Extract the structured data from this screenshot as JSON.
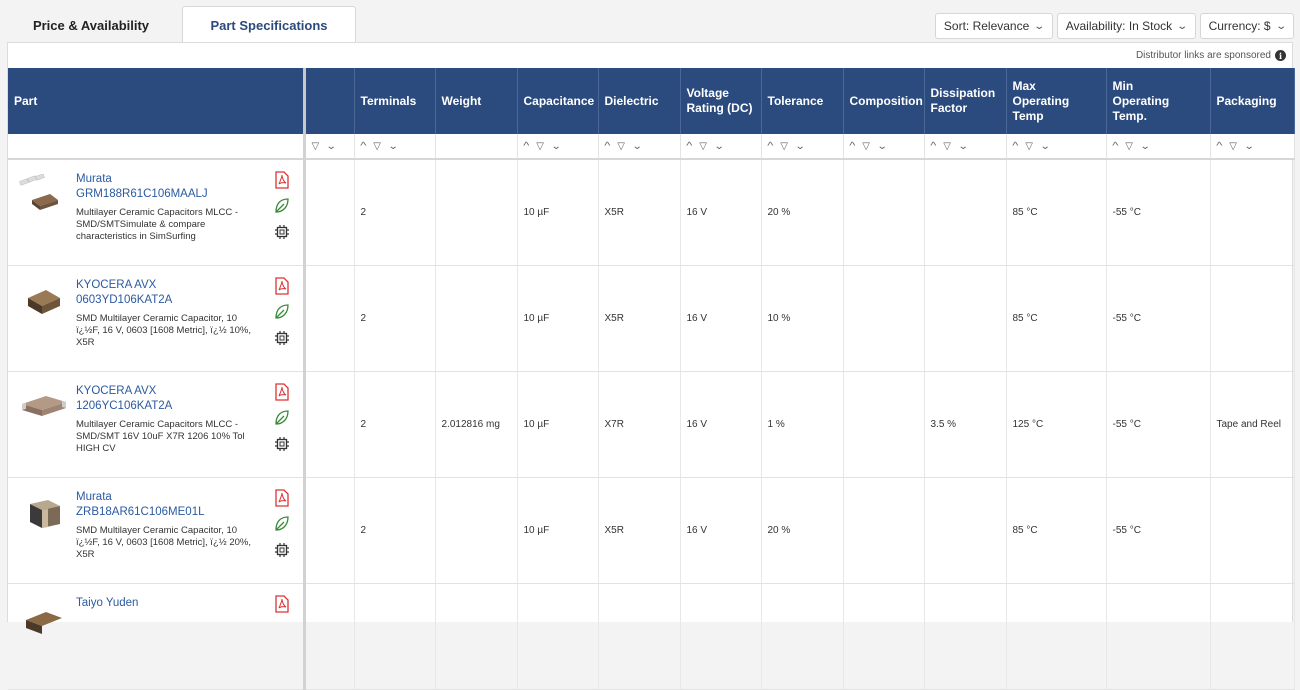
{
  "tabs": [
    {
      "label": "Price & Availability",
      "active": false
    },
    {
      "label": "Part Specifications",
      "active": true
    }
  ],
  "controls": {
    "sort": "Sort: Relevance",
    "availability": "Availability: In Stock",
    "currency": "Currency: $"
  },
  "sponsored_note": "Distributor links are sponsored",
  "columns": {
    "part": "Part",
    "blank": "",
    "terminals": "Terminals",
    "weight": "Weight",
    "capacitance": "Capacitance",
    "dielectric": "Dielectric",
    "voltage_l1": "Voltage",
    "voltage_l2": "Rating (DC)",
    "tolerance": "Tolerance",
    "composition": "Composition",
    "dissipation_l1": "Dissipation",
    "dissipation_l2": "Factor",
    "maxtemp_l1": "Max",
    "maxtemp_l2": "Operating Temp",
    "mintemp_l1": "Min",
    "mintemp_l2": "Operating Temp.",
    "packaging": "Packaging"
  },
  "rows": [
    {
      "manufacturer": "Murata",
      "part_number": "GRM188R61C106MAALJ",
      "description": "Multilayer Ceramic Capacitors MLCC - SMD/SMTSimulate & compare characteristics in SimSurfing",
      "terminals": "2",
      "weight": "",
      "capacitance": "10 µF",
      "dielectric": "X5R",
      "voltage": "16 V",
      "tolerance": "20 %",
      "composition": "",
      "dissipation": "",
      "max_temp": "85 °C",
      "min_temp": "-55 °C",
      "packaging": ""
    },
    {
      "manufacturer": "KYOCERA AVX",
      "part_number": "0603YD106KAT2A",
      "description": "SMD Multilayer Ceramic Capacitor, 10 ï¿½F, 16 V, 0603 [1608 Metric], ï¿½ 10%, X5R",
      "terminals": "2",
      "weight": "",
      "capacitance": "10 µF",
      "dielectric": "X5R",
      "voltage": "16 V",
      "tolerance": "10 %",
      "composition": "",
      "dissipation": "",
      "max_temp": "85 °C",
      "min_temp": "-55 °C",
      "packaging": ""
    },
    {
      "manufacturer": "KYOCERA AVX",
      "part_number": "1206YC106KAT2A",
      "description": "Multilayer Ceramic Capacitors MLCC - SMD/SMT 16V 10uF X7R 1206 10% Tol HIGH CV",
      "terminals": "2",
      "weight": "2.012816 mg",
      "capacitance": "10 µF",
      "dielectric": "X7R",
      "voltage": "16 V",
      "tolerance": "1 %",
      "composition": "",
      "dissipation": "3.5 %",
      "max_temp": "125 °C",
      "min_temp": "-55 °C",
      "packaging": "Tape and Reel"
    },
    {
      "manufacturer": "Murata",
      "part_number": "ZRB18AR61C106ME01L",
      "description": "SMD Multilayer Ceramic Capacitor, 10 ï¿½F, 16 V, 0603 [1608 Metric], ï¿½ 20%, X5R",
      "terminals": "2",
      "weight": "",
      "capacitance": "10 µF",
      "dielectric": "X5R",
      "voltage": "16 V",
      "tolerance": "20 %",
      "composition": "",
      "dissipation": "",
      "max_temp": "85 °C",
      "min_temp": "-55 °C",
      "packaging": ""
    },
    {
      "manufacturer": "Taiyo Yuden",
      "part_number": "",
      "description": "",
      "terminals": "",
      "weight": "",
      "capacitance": "",
      "dielectric": "",
      "voltage": "",
      "tolerance": "",
      "composition": "",
      "dissipation": "",
      "max_temp": "",
      "min_temp": "",
      "packaging": ""
    }
  ],
  "icons": {
    "info": "info-icon",
    "datasheet": "pdf-icon",
    "environmental": "leaf-icon",
    "cad_model": "chip-icon",
    "filter": "funnel-icon",
    "sort_up": "chevron-up-icon",
    "sort_down": "chevron-down-icon"
  },
  "colors": {
    "header_bg": "#2b4b7e",
    "link": "#2b5aa0",
    "pdf": "#d33333",
    "leaf": "#3a8a3a"
  }
}
